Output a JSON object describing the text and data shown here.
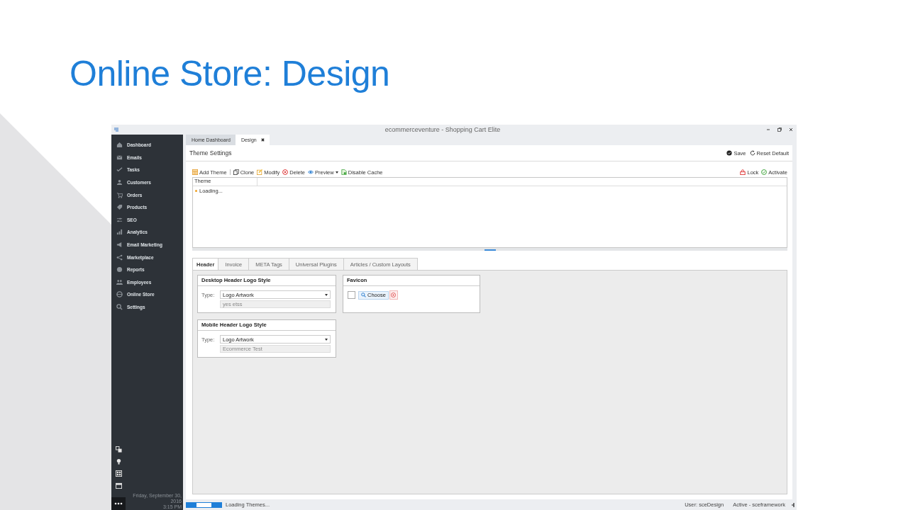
{
  "slide": {
    "title": "Online Store: Design"
  },
  "window": {
    "title": "ecommerceventure - Shopping Cart Elite"
  },
  "sidebar": {
    "items": [
      {
        "label": "Dashboard",
        "selected": false
      },
      {
        "label": "Emails",
        "selected": false
      },
      {
        "label": "Tasks",
        "selected": false
      },
      {
        "label": "Customers",
        "selected": false
      },
      {
        "label": "Orders",
        "selected": false
      },
      {
        "label": "Products",
        "selected": false
      },
      {
        "label": "SEO",
        "selected": false
      },
      {
        "label": "Analytics",
        "selected": false
      },
      {
        "label": "Email Marketing",
        "selected": false
      },
      {
        "label": "Marketplace",
        "selected": false
      },
      {
        "label": "Reports",
        "selected": false
      },
      {
        "label": "Employees",
        "selected": false
      },
      {
        "label": "Online Store",
        "selected": false
      },
      {
        "label": "Settings",
        "selected": false
      }
    ],
    "date": "Friday, September 30, 2016",
    "time": "3:15 PM"
  },
  "doc_tabs": [
    {
      "label": "Home Dashboard",
      "selected": false,
      "closable": false
    },
    {
      "label": "Design",
      "selected": true,
      "closable": true
    }
  ],
  "panel": {
    "title": "Theme Settings",
    "actions": [
      {
        "label": "Save"
      },
      {
        "label": "Reset Default"
      }
    ]
  },
  "toolbar": {
    "left": [
      {
        "label": "Add Theme",
        "dropdown": false
      },
      {
        "label": "Clone",
        "dropdown": false
      },
      {
        "label": "Modify",
        "dropdown": false
      },
      {
        "label": "Delete",
        "dropdown": false
      },
      {
        "label": "Preview",
        "dropdown": true
      },
      {
        "label": "Disable Cache",
        "dropdown": false
      }
    ],
    "right": [
      {
        "label": "Lock"
      },
      {
        "label": "Activate"
      }
    ]
  },
  "grid": {
    "columns": [
      "Theme"
    ],
    "rows": [
      {
        "text": "Loading..."
      }
    ]
  },
  "section_tabs": [
    {
      "label": "Header",
      "selected": true
    },
    {
      "label": "Invoice",
      "selected": false
    },
    {
      "label": "META Tags",
      "selected": false
    },
    {
      "label": "Universal Plugins",
      "selected": false
    },
    {
      "label": "Articles / Custom Layouts",
      "selected": false
    }
  ],
  "cards": [
    {
      "kind": "logo",
      "title": "Desktop Header Logo Style",
      "type_label": "Type:",
      "select_value": "Logo Artwork",
      "text_value": "yes etss"
    },
    {
      "kind": "favicon",
      "title": "Favicon",
      "button": "Choose"
    },
    {
      "kind": "logo",
      "title": "Mobile Header Logo Style",
      "type_label": "Type:",
      "select_value": "Logo Artwork",
      "text_value": "Ecommerce Test"
    }
  ],
  "status_bar": {
    "message": "Loading Themes...",
    "user": "User: sceDesign",
    "state": "Active - sceframework"
  }
}
